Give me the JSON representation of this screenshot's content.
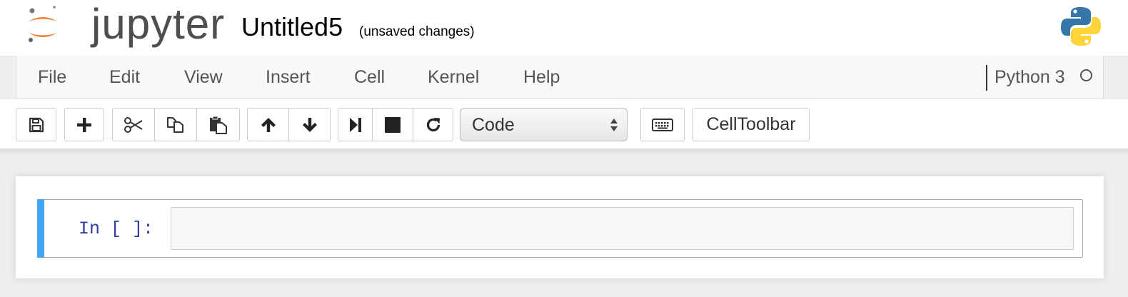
{
  "header": {
    "logo_text": "jupyter",
    "notebook_name": "Untitled5",
    "save_status": "(unsaved changes)",
    "logo_icon": "jupyter-logo-icon",
    "kernel_logo_icon": "python-logo-icon"
  },
  "menubar": {
    "items": [
      "File",
      "Edit",
      "View",
      "Insert",
      "Cell",
      "Kernel",
      "Help"
    ],
    "kernel_name": "Python 3",
    "kernel_status": "idle"
  },
  "toolbar": {
    "icons": [
      "save-icon",
      "plus-icon",
      "scissors-icon",
      "copy-icon",
      "paste-icon",
      "arrow-up-icon",
      "arrow-down-icon",
      "step-forward-icon",
      "stop-icon",
      "refresh-icon",
      "keyboard-icon"
    ],
    "cell_type": "Code",
    "cell_type_options": [
      "Code"
    ],
    "celltoolbar_label": "CellToolbar"
  },
  "cell": {
    "prompt": "In [ ]:",
    "input_value": "",
    "selected_color": "#42a5f5"
  },
  "colors": {
    "jupyter_orange": "#f37726",
    "python_blue": "#3776ab",
    "python_yellow": "#ffd43b"
  }
}
